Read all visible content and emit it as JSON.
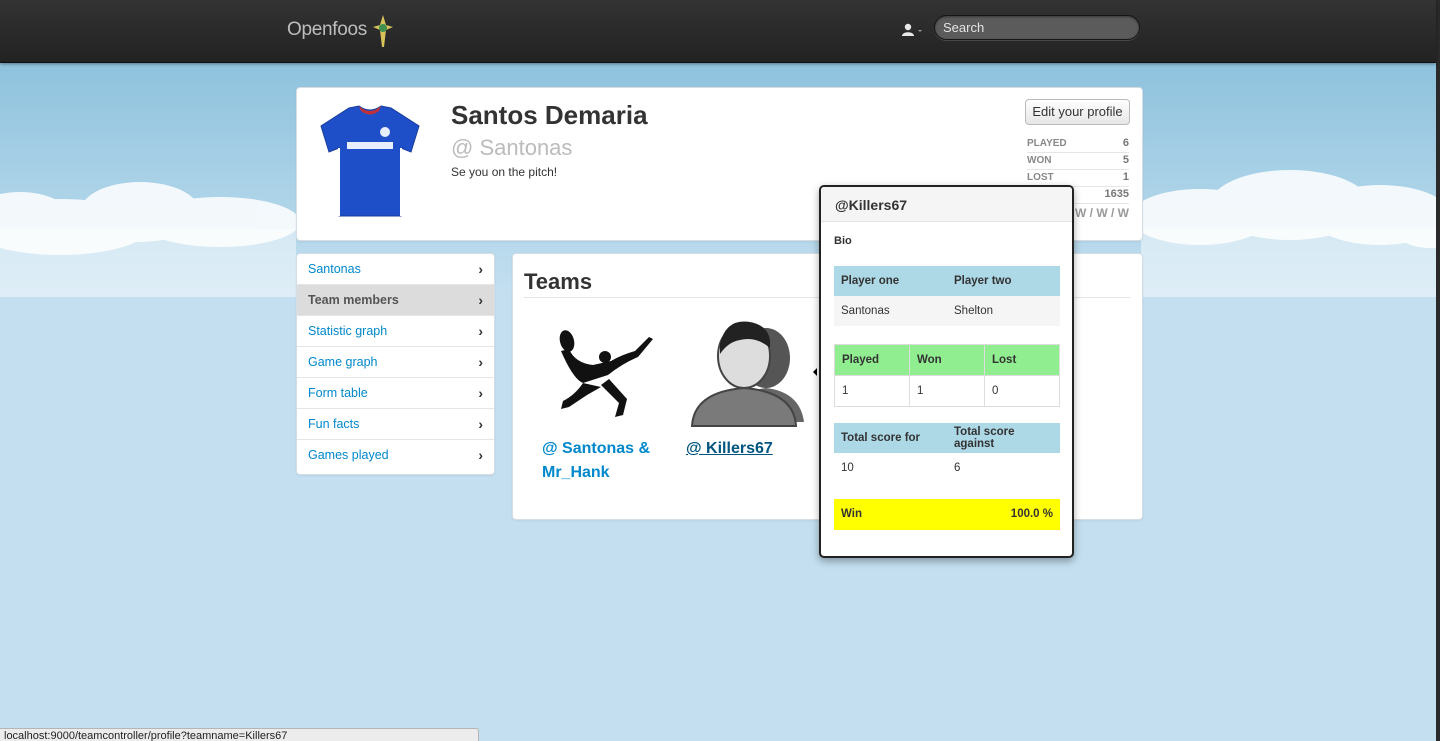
{
  "navbar": {
    "brand": "Openfoos",
    "search_placeholder": "Search"
  },
  "profile": {
    "name": "Santos Demaria",
    "handle": "@ Santonas",
    "bio": "Se you on the pitch!",
    "edit_label": "Edit your profile",
    "stats": [
      {
        "label": "PLAYED",
        "value": "6"
      },
      {
        "label": "WON",
        "value": "5"
      },
      {
        "label": "LOST",
        "value": "1"
      },
      {
        "label": "",
        "value": "1635"
      }
    ],
    "form": "W / W / W"
  },
  "sidenav": {
    "items": [
      {
        "label": "Santonas"
      },
      {
        "label": "Team members"
      },
      {
        "label": "Statistic graph"
      },
      {
        "label": "Game graph"
      },
      {
        "label": "Form table"
      },
      {
        "label": "Fun facts"
      },
      {
        "label": "Games played"
      }
    ]
  },
  "teams": {
    "title": "Teams",
    "items": [
      {
        "label": "@ Santonas & Mr_Hank"
      },
      {
        "label": "@ Killers67"
      }
    ]
  },
  "popover": {
    "title": "@Killers67",
    "bio_label": "Bio",
    "players": {
      "headers": [
        "Player one",
        "Player two"
      ],
      "values": [
        "Santonas",
        "Shelton"
      ]
    },
    "results": {
      "headers": [
        "Played",
        "Won",
        "Lost"
      ],
      "values": [
        "1",
        "1",
        "0"
      ]
    },
    "scores": {
      "headers": [
        "Total score for",
        "Total score against"
      ],
      "values": [
        "10",
        "6"
      ]
    },
    "win": {
      "label": "Win",
      "value": "100.0 %"
    }
  },
  "statusbar": {
    "url": "localhost:9000/teamcontroller/profile?teamname=Killers67"
  },
  "colors": {
    "link": "#0088cc",
    "navbar": "#2b2b2b",
    "sky": "#c3dff0",
    "players_header": "#add8e6",
    "results_header": "#90ee90",
    "win_bar": "#ffff00"
  }
}
